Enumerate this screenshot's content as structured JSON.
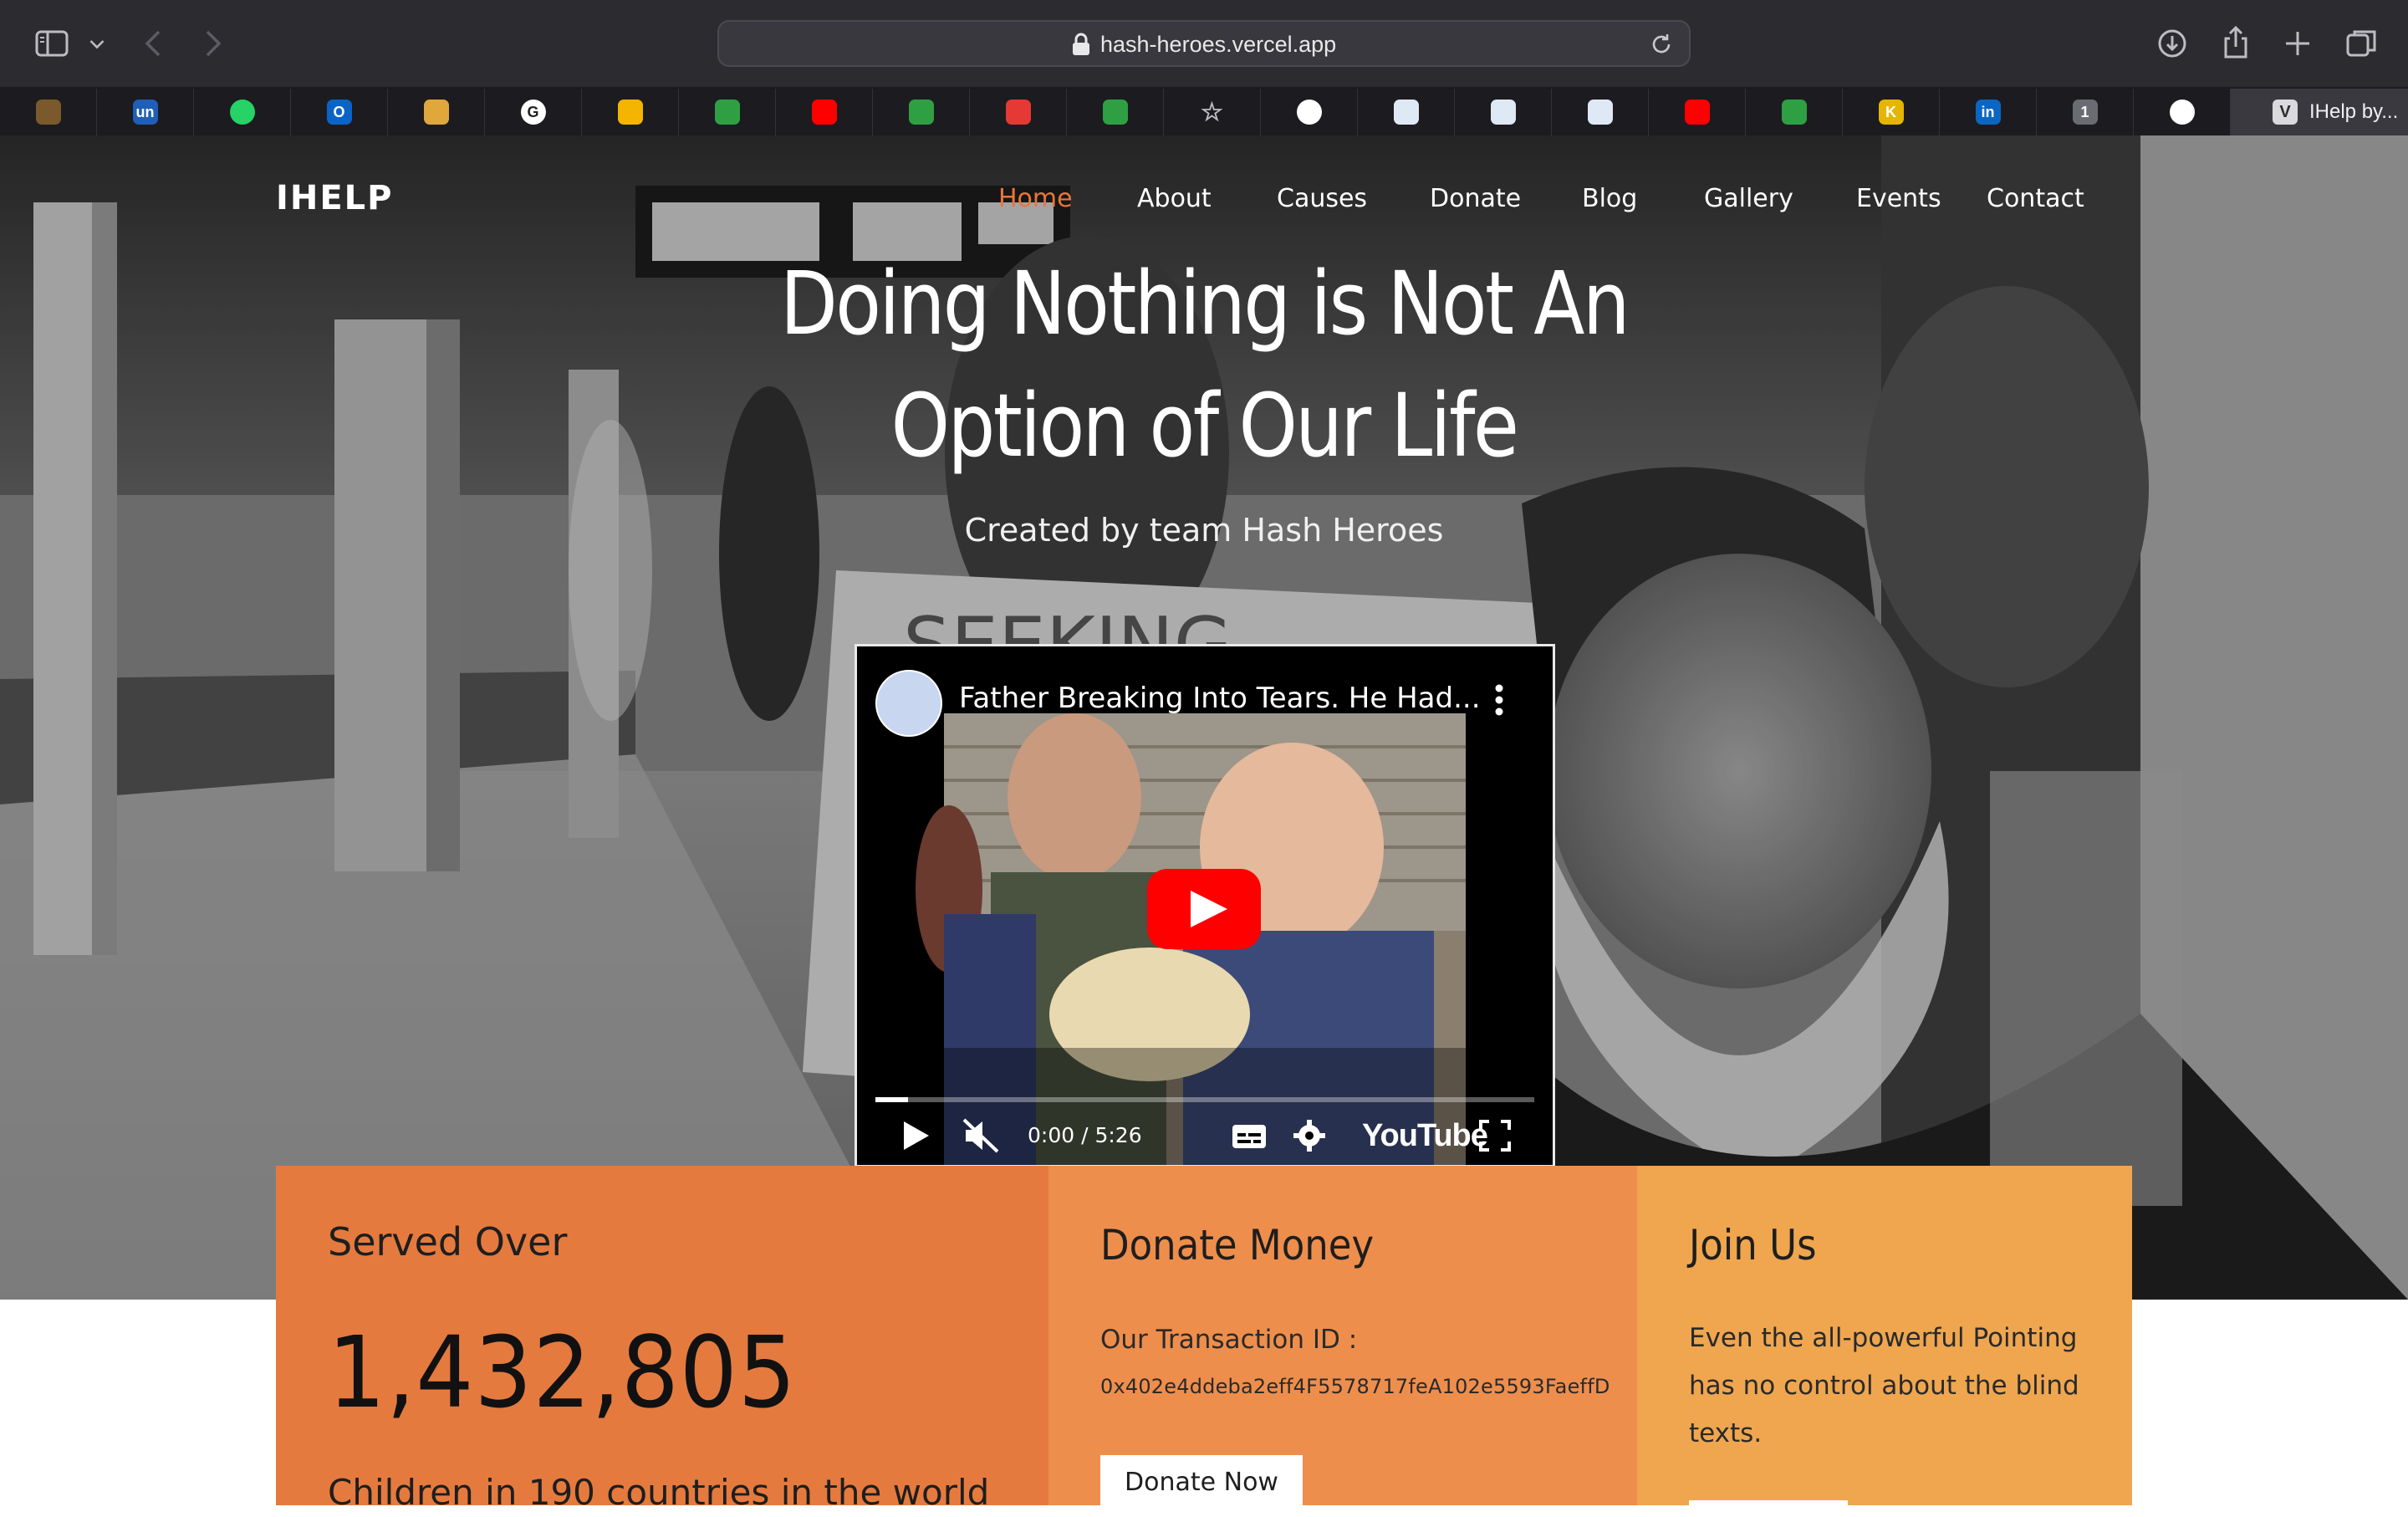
{
  "browser": {
    "url": "hash-heroes.vercel.app",
    "active_tab": {
      "initial": "V",
      "title": "IHelp by..."
    },
    "favorites": [
      {
        "icon": "notion-boring-icon",
        "text": "",
        "color": "#7a5a2c"
      },
      {
        "icon": "unstop-icon",
        "text": "un",
        "color": "#1f5fb8"
      },
      {
        "icon": "whatsapp-icon",
        "text": "",
        "color": "#25d366"
      },
      {
        "icon": "outlook-icon",
        "text": "O",
        "color": "#0a64c8"
      },
      {
        "icon": "emoji-icon",
        "text": "",
        "color": "#e0a83a"
      },
      {
        "icon": "google-icon",
        "text": "G",
        "color": "#ffffff"
      },
      {
        "icon": "drive-icon",
        "text": "",
        "color": "#f4b400"
      },
      {
        "icon": "green-app-icon",
        "text": "",
        "color": "#2ea043"
      },
      {
        "icon": "youtube-icon",
        "text": "",
        "color": "#ff0000"
      },
      {
        "icon": "green-app-icon",
        "text": "",
        "color": "#2ea043"
      },
      {
        "icon": "red-app-icon",
        "text": "",
        "color": "#e53935"
      },
      {
        "icon": "green-app-icon",
        "text": "",
        "color": "#2ea043"
      },
      {
        "icon": "star-icon",
        "text": "☆",
        "color": "transparent"
      },
      {
        "icon": "github-icon",
        "text": "",
        "color": "#ffffff"
      },
      {
        "icon": "badge-icon",
        "text": "",
        "color": "#dfe8f5"
      },
      {
        "icon": "badge-icon",
        "text": "",
        "color": "#dfe8f5"
      },
      {
        "icon": "badge-icon",
        "text": "",
        "color": "#dfe8f5"
      },
      {
        "icon": "youtube-icon",
        "text": "",
        "color": "#ff0000"
      },
      {
        "icon": "shield-icon",
        "text": "",
        "color": "#2ea043"
      },
      {
        "icon": "k-icon",
        "text": "K",
        "color": "#e6b500"
      },
      {
        "icon": "linkedin-icon",
        "text": "in",
        "color": "#0a66c2"
      },
      {
        "icon": "one-icon",
        "text": "1",
        "color": "#6b6b72"
      },
      {
        "icon": "github-icon",
        "text": "",
        "color": "#ffffff"
      }
    ]
  },
  "site": {
    "brand": "IHELP",
    "nav": [
      "Home",
      "About",
      "Causes",
      "Donate",
      "Blog",
      "Gallery",
      "Events",
      "Contact"
    ],
    "active_nav": "Home",
    "accent": "#e8763c",
    "hero_title_line1": "Doing Nothing is Not An",
    "hero_title_line2": "Option of Our Life",
    "hero_subtitle": "Created by team Hash Heroes"
  },
  "video": {
    "title": "Father Breaking Into Tears. He Had...",
    "time": "0:00 / 5:26",
    "progress": 0.05,
    "brand": "YouTube"
  },
  "cards": {
    "served": {
      "heading": "Served Over",
      "number": "1,432,805",
      "desc": "Children in 190 countries in the world",
      "color": "#e57a3f"
    },
    "donate": {
      "heading": "Donate Money",
      "label": "Our Transaction ID :",
      "tx": "0x402e4ddeba2eff4F5578717feA102e5593FaeffD",
      "button": "Donate Now",
      "color": "#ee8e4c"
    },
    "join": {
      "heading": "Join Us",
      "text": "Even the all-powerful Pointing has no control about the blind texts.",
      "color": "#efa64f"
    }
  }
}
